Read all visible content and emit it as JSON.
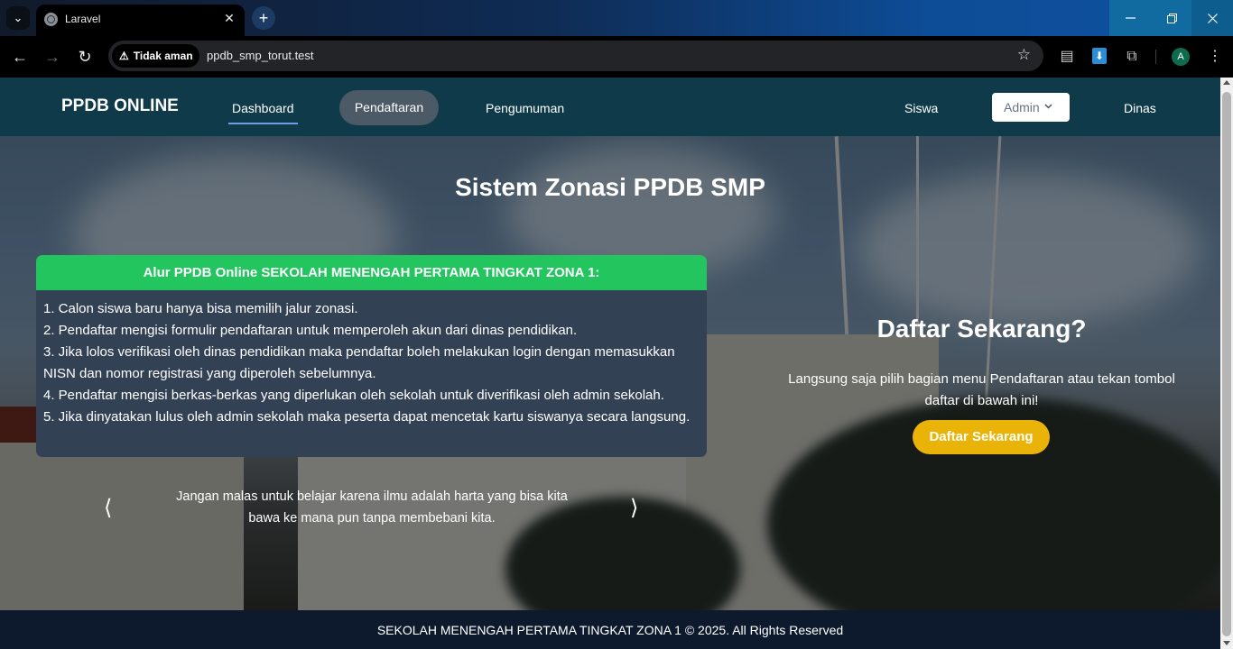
{
  "browser": {
    "tab_title": "Laravel",
    "tab_close": "✕",
    "new_tab": "+",
    "security_label": "Tidak aman",
    "url": "ppdb_smp_torut.test",
    "profile_initial": "A"
  },
  "nav": {
    "brand": "PPDB ONLINE",
    "items": [
      {
        "label": "Dashboard"
      },
      {
        "label": "Pendaftaran"
      },
      {
        "label": "Pengumuman"
      },
      {
        "label": "Siswa"
      },
      {
        "label": "Admin"
      },
      {
        "label": "Dinas"
      }
    ]
  },
  "hero": {
    "title": "Sistem Zonasi PPDB SMP",
    "alur": {
      "heading": "Alur PPDB Online SEKOLAH MENENGAH PERTAMA TINGKAT ZONA 1:",
      "steps": [
        "1. Calon siswa baru hanya bisa memilih jalur zonasi.",
        "2. Pendaftar mengisi formulir pendaftaran untuk memperoleh akun dari dinas pendidikan.",
        "3. Jika lolos verifikasi oleh dinas pendidikan maka pendaftar boleh melakukan login dengan memasukkan NISN dan nomor registrasi yang diperoleh sebelumnya.",
        "4. Pendaftar mengisi berkas-berkas yang diperlukan oleh sekolah untuk diverifikasi oleh admin sekolah.",
        "5. Jika dinyatakan lulus oleh admin sekolah maka peserta dapat mencetak kartu siswanya secara langsung."
      ]
    },
    "quote": "Jangan malas untuk belajar karena ilmu adalah harta yang bisa kita bawa ke mana pun tanpa membebani kita.",
    "carousel_prev": "⟨",
    "carousel_next": "⟩",
    "cta": {
      "title": "Daftar Sekarang?",
      "text": "Langsung saja pilih bagian menu Pendaftaran atau tekan tombol daftar di bawah ini!",
      "button": "Daftar Sekarang"
    }
  },
  "footer": {
    "text": "SEKOLAH MENENGAH PERTAMA TINGKAT ZONA 1 © 2025. All Rights Reserved"
  },
  "colors": {
    "nav_bg": "#0f3a4a",
    "card_header": "#22c55e",
    "card_body": "#334155",
    "cta_button": "#eab308",
    "footer_bg": "#0d1a2d"
  },
  "icons": [
    "tab-search-icon",
    "globe-icon",
    "close-icon",
    "plus-icon",
    "back-icon",
    "forward-icon",
    "reload-icon",
    "warning-icon",
    "star-icon",
    "document-icon",
    "download-icon",
    "extensions-icon",
    "kebab-menu-icon",
    "chevron-down-icon"
  ]
}
